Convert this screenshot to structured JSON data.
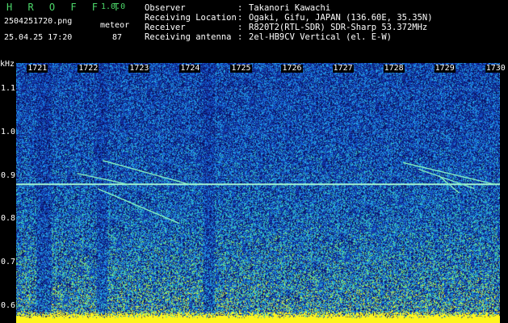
{
  "header": {
    "app_title": "H R O F F T",
    "version": "1.0.0",
    "file_name": "2504251720.png",
    "datetime": "25.04.25 17:20",
    "mode": "meteor",
    "count": "87"
  },
  "info": {
    "observer": {
      "key": "Observer",
      "value": "Takanori Kawachi"
    },
    "location": {
      "key": "Receiving Location",
      "value": "Ogaki, Gifu, JAPAN (136.60E, 35.35N)"
    },
    "receiver": {
      "key": "Receiver",
      "value": "R820T2(RTL-SDR) SDR-Sharp 53.372MHz"
    },
    "antenna": {
      "key": "Receiving antenna",
      "value": "2el-HB9CV Vertical (el. E-W)"
    }
  },
  "colors": {
    "background": "#000000",
    "spectrogram_base": "#10207a",
    "title_green": "#4cd86a",
    "signal_yellow": "#ffff00"
  },
  "chart_data": {
    "type": "heatmap",
    "xlabel": "",
    "ylabel": "kHz",
    "x_ticks": [
      "1721",
      "1722",
      "1723",
      "1724",
      "1725",
      "1726",
      "1727",
      "1728",
      "1729",
      "1730"
    ],
    "y_ticks": [
      "1.1",
      "1.0",
      "0.9",
      "0.8",
      "0.7",
      "0.6"
    ],
    "x_range": [
      1720.6,
      1730.1
    ],
    "y_range": [
      0.56,
      1.16
    ],
    "carrier_khz": 0.88,
    "meteor_traces": [
      {
        "t0": 1722.3,
        "f0": 0.935,
        "t1": 1724.0,
        "f1": 0.88
      },
      {
        "t0": 1722.2,
        "f0": 0.87,
        "t1": 1723.8,
        "f1": 0.79
      },
      {
        "t0": 1721.8,
        "f0": 0.905,
        "t1": 1722.8,
        "f1": 0.88
      },
      {
        "t0": 1728.2,
        "f0": 0.93,
        "t1": 1730.0,
        "f1": 0.88
      },
      {
        "t0": 1728.5,
        "f0": 0.915,
        "t1": 1729.6,
        "f1": 0.87
      },
      {
        "t0": 1728.9,
        "f0": 0.9,
        "t1": 1729.3,
        "f1": 0.86
      }
    ]
  }
}
